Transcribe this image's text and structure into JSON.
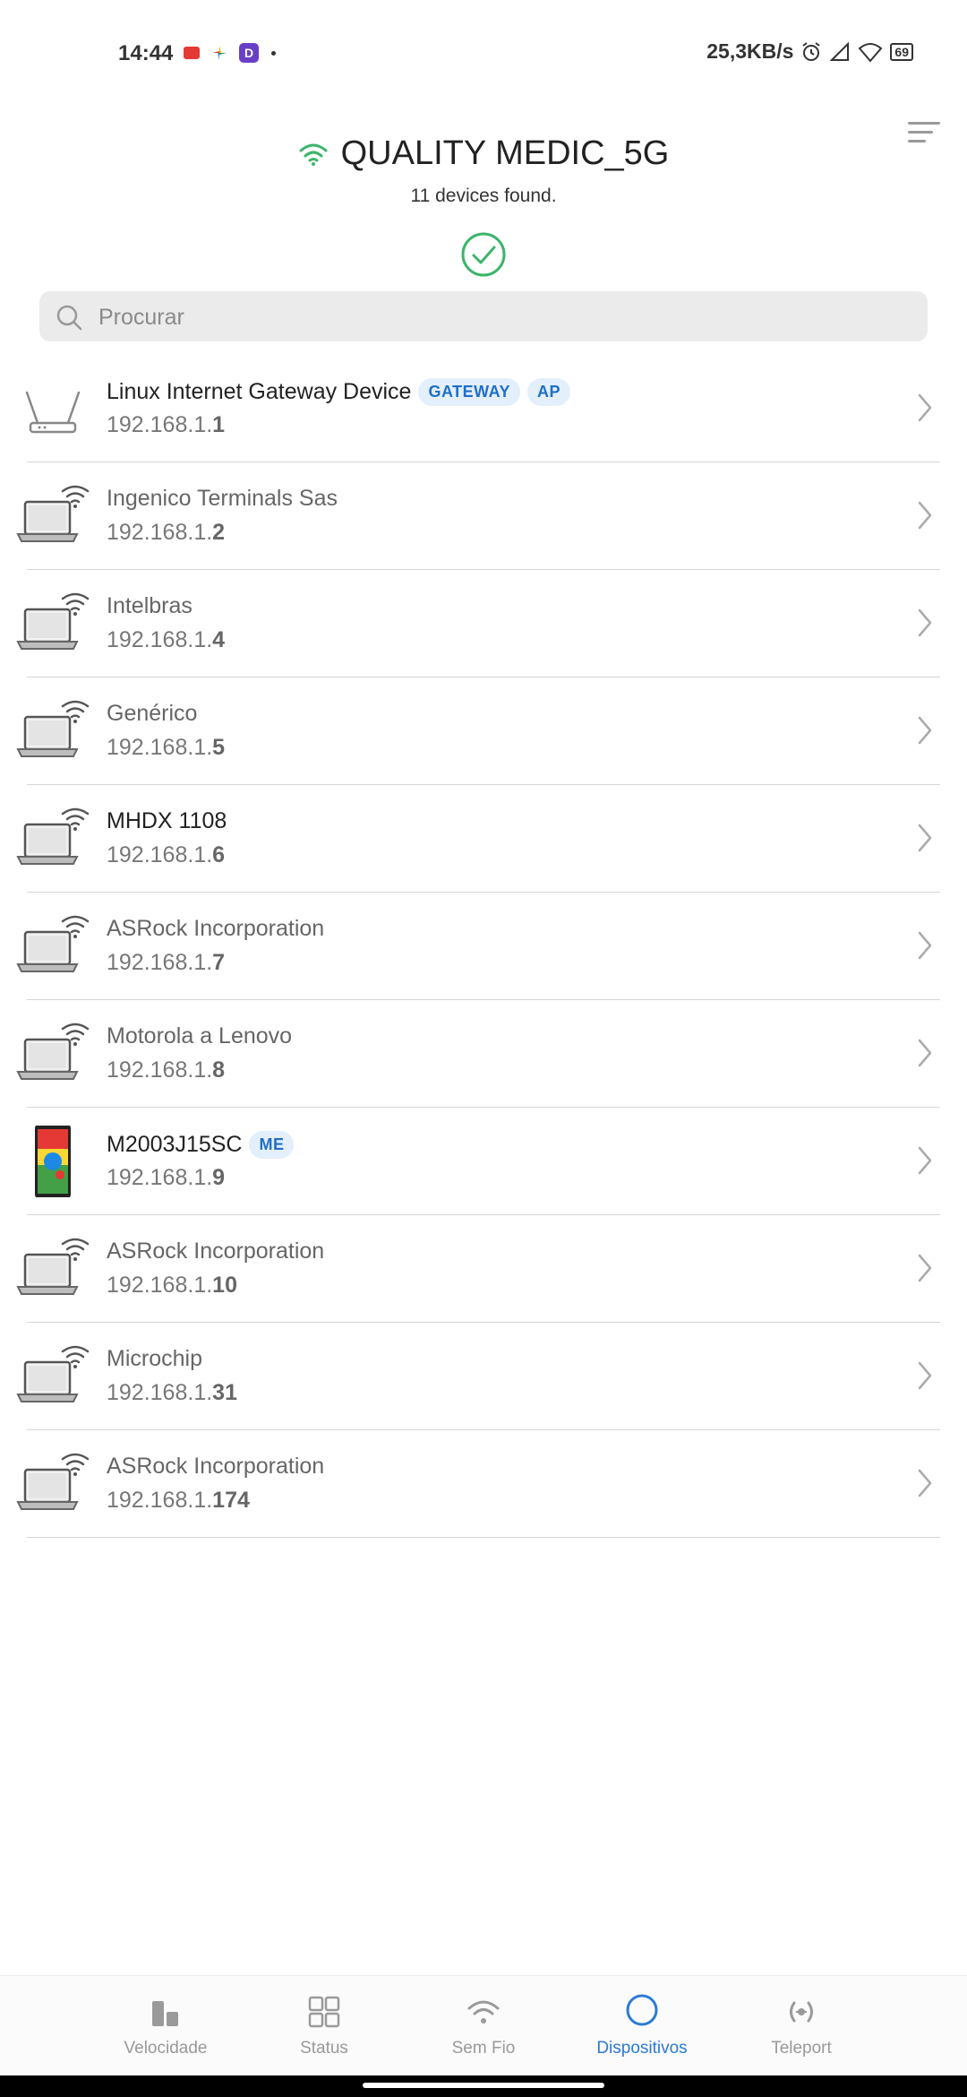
{
  "status_bar": {
    "time": "14:44",
    "speed": "25,3KB/s",
    "battery": "69"
  },
  "header": {
    "ssid": "QUALITY MEDIC_5G",
    "devices_found": "11 devices found."
  },
  "search": {
    "placeholder": "Procurar"
  },
  "devices": [
    {
      "name": "Linux Internet Gateway Device",
      "ip_prefix": "192.168.1.",
      "ip_suffix": "1",
      "badges": [
        "GATEWAY",
        "AP"
      ],
      "icon": "router-icon"
    },
    {
      "name": "Ingenico Terminals Sas",
      "ip_prefix": "192.168.1.",
      "ip_suffix": "2",
      "icon": "laptop-wifi-icon"
    },
    {
      "name": "Intelbras",
      "ip_prefix": "192.168.1.",
      "ip_suffix": "4",
      "icon": "laptop-wifi-icon"
    },
    {
      "name": "Genérico",
      "ip_prefix": "192.168.1.",
      "ip_suffix": "5",
      "icon": "laptop-wifi-icon"
    },
    {
      "name": "MHDX 1108",
      "ip_prefix": "192.168.1.",
      "ip_suffix": "6",
      "icon": "laptop-wifi-icon"
    },
    {
      "name": "ASRock Incorporation",
      "ip_prefix": "192.168.1.",
      "ip_suffix": "7",
      "icon": "laptop-wifi-icon"
    },
    {
      "name": "Motorola a Lenovo",
      "ip_prefix": "192.168.1.",
      "ip_suffix": "8",
      "icon": "laptop-wifi-icon"
    },
    {
      "name": "M2003J15SC",
      "ip_prefix": "192.168.1.",
      "ip_suffix": "9",
      "badges": [
        "ME"
      ],
      "icon": "smartphone-icon"
    },
    {
      "name": "ASRock Incorporation",
      "ip_prefix": "192.168.1.",
      "ip_suffix": "10",
      "icon": "laptop-wifi-icon"
    },
    {
      "name": "Microchip",
      "ip_prefix": "192.168.1.",
      "ip_suffix": "31",
      "icon": "laptop-wifi-icon"
    },
    {
      "name": "ASRock Incorporation",
      "ip_prefix": "192.168.1.",
      "ip_suffix": "174",
      "icon": "laptop-wifi-icon"
    }
  ],
  "nav": {
    "speed": "Velocidade",
    "status": "Status",
    "wireless": "Sem Fio",
    "devices": "Dispositivos",
    "teleport": "Teleport"
  },
  "colors": {
    "accent": "#2b7bd6",
    "wifi_green": "#3bb56a",
    "badge_bg": "#e3effb"
  }
}
